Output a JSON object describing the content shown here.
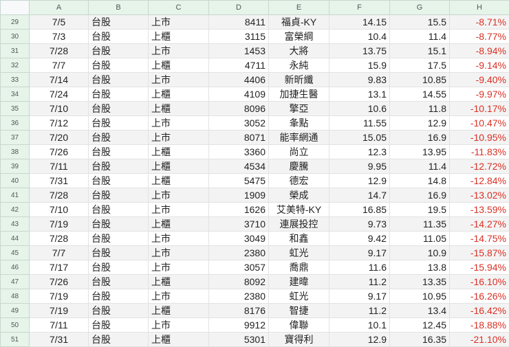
{
  "columns": [
    "A",
    "B",
    "C",
    "D",
    "E",
    "F",
    "G",
    "H"
  ],
  "rows": [
    {
      "n": "29",
      "a": "7/5",
      "b": "台股",
      "c": "上市",
      "d": "8411",
      "e": "福貞-KY",
      "f": "14.15",
      "g": "15.5",
      "h": "-8.71%"
    },
    {
      "n": "30",
      "a": "7/3",
      "b": "台股",
      "c": "上櫃",
      "d": "3115",
      "e": "富榮綱",
      "f": "10.4",
      "g": "11.4",
      "h": "-8.77%"
    },
    {
      "n": "31",
      "a": "7/28",
      "b": "台股",
      "c": "上市",
      "d": "1453",
      "e": "大將",
      "f": "13.75",
      "g": "15.1",
      "h": "-8.94%"
    },
    {
      "n": "32",
      "a": "7/7",
      "b": "台股",
      "c": "上櫃",
      "d": "4711",
      "e": "永純",
      "f": "15.9",
      "g": "17.5",
      "h": "-9.14%"
    },
    {
      "n": "33",
      "a": "7/14",
      "b": "台股",
      "c": "上市",
      "d": "4406",
      "e": "新昕纖",
      "f": "9.83",
      "g": "10.85",
      "h": "-9.40%"
    },
    {
      "n": "34",
      "a": "7/24",
      "b": "台股",
      "c": "上櫃",
      "d": "4109",
      "e": "加捷生醫",
      "f": "13.1",
      "g": "14.55",
      "h": "-9.97%"
    },
    {
      "n": "35",
      "a": "7/10",
      "b": "台股",
      "c": "上櫃",
      "d": "8096",
      "e": "擎亞",
      "f": "10.6",
      "g": "11.8",
      "h": "-10.17%"
    },
    {
      "n": "36",
      "a": "7/12",
      "b": "台股",
      "c": "上市",
      "d": "3052",
      "e": "夆點",
      "f": "11.55",
      "g": "12.9",
      "h": "-10.47%"
    },
    {
      "n": "37",
      "a": "7/20",
      "b": "台股",
      "c": "上市",
      "d": "8071",
      "e": "能率網通",
      "f": "15.05",
      "g": "16.9",
      "h": "-10.95%"
    },
    {
      "n": "38",
      "a": "7/26",
      "b": "台股",
      "c": "上櫃",
      "d": "3360",
      "e": "尚立",
      "f": "12.3",
      "g": "13.95",
      "h": "-11.83%"
    },
    {
      "n": "39",
      "a": "7/11",
      "b": "台股",
      "c": "上櫃",
      "d": "4534",
      "e": "慶騰",
      "f": "9.95",
      "g": "11.4",
      "h": "-12.72%"
    },
    {
      "n": "40",
      "a": "7/31",
      "b": "台股",
      "c": "上櫃",
      "d": "5475",
      "e": "德宏",
      "f": "12.9",
      "g": "14.8",
      "h": "-12.84%"
    },
    {
      "n": "41",
      "a": "7/28",
      "b": "台股",
      "c": "上市",
      "d": "1909",
      "e": "榮成",
      "f": "14.7",
      "g": "16.9",
      "h": "-13.02%"
    },
    {
      "n": "42",
      "a": "7/10",
      "b": "台股",
      "c": "上市",
      "d": "1626",
      "e": "艾美特-KY",
      "f": "16.85",
      "g": "19.5",
      "h": "-13.59%"
    },
    {
      "n": "43",
      "a": "7/19",
      "b": "台股",
      "c": "上櫃",
      "d": "3710",
      "e": "連展投控",
      "f": "9.73",
      "g": "11.35",
      "h": "-14.27%"
    },
    {
      "n": "44",
      "a": "7/28",
      "b": "台股",
      "c": "上市",
      "d": "3049",
      "e": "和鑫",
      "f": "9.42",
      "g": "11.05",
      "h": "-14.75%"
    },
    {
      "n": "45",
      "a": "7/7",
      "b": "台股",
      "c": "上市",
      "d": "2380",
      "e": "虹光",
      "f": "9.17",
      "g": "10.9",
      "h": "-15.87%"
    },
    {
      "n": "46",
      "a": "7/17",
      "b": "台股",
      "c": "上市",
      "d": "3057",
      "e": "喬鼎",
      "f": "11.6",
      "g": "13.8",
      "h": "-15.94%"
    },
    {
      "n": "47",
      "a": "7/26",
      "b": "台股",
      "c": "上櫃",
      "d": "8092",
      "e": "建暐",
      "f": "11.2",
      "g": "13.35",
      "h": "-16.10%"
    },
    {
      "n": "48",
      "a": "7/19",
      "b": "台股",
      "c": "上市",
      "d": "2380",
      "e": "虹光",
      "f": "9.17",
      "g": "10.95",
      "h": "-16.26%"
    },
    {
      "n": "49",
      "a": "7/19",
      "b": "台股",
      "c": "上櫃",
      "d": "8176",
      "e": "智捷",
      "f": "11.2",
      "g": "13.4",
      "h": "-16.42%"
    },
    {
      "n": "50",
      "a": "7/11",
      "b": "台股",
      "c": "上市",
      "d": "9912",
      "e": "偉聯",
      "f": "10.1",
      "g": "12.45",
      "h": "-18.88%"
    },
    {
      "n": "51",
      "a": "7/31",
      "b": "台股",
      "c": "上櫃",
      "d": "5301",
      "e": "寶得利",
      "f": "12.9",
      "g": "16.35",
      "h": "-21.10%"
    }
  ]
}
